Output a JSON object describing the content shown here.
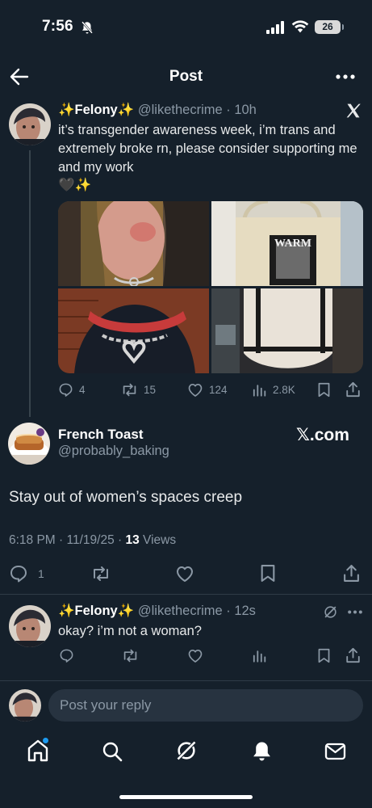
{
  "status_bar": {
    "time": "7:56",
    "battery": "26"
  },
  "header": {
    "title": "Post"
  },
  "parent_tweet": {
    "emoji_left": "✨",
    "author_name": "Felony",
    "emoji_right": "✨",
    "handle": "@likethecrime",
    "time": "10h",
    "text": "it’s transgender awareness week, i’m trans and extremely broke rn, please consider supporting me and my work",
    "text_emoji": "🖤✨",
    "media_label": "WARM",
    "actions": {
      "replies": "4",
      "reposts": "15",
      "likes": "124",
      "views": "2.8K"
    }
  },
  "quote_tweet": {
    "author_name": "French Toast",
    "handle": "@probably_baking",
    "watermark": "𝕏.com",
    "text": "Stay out of women’s spaces creep",
    "timestamp": "6:18 PM · 11/19/25 · ",
    "views_count": "13",
    "views_label": " Views",
    "actions": {
      "replies": "1"
    }
  },
  "reply_tweet": {
    "emoji_left": "✨",
    "author_name": "Felony",
    "emoji_right": "✨",
    "handle": "@likethecrime",
    "time": "12s",
    "text": "okay? i’m not a woman?"
  },
  "reply_box": {
    "placeholder": "Post your reply"
  },
  "tab_bar": {
    "items": [
      "home-icon",
      "search-icon",
      "grok-icon",
      "notifications-icon",
      "messages-icon"
    ]
  },
  "colors": {
    "background": "#15202b",
    "accent": "#1d9bf0",
    "muted": "#8b98a5",
    "divider": "#2f3b47"
  }
}
